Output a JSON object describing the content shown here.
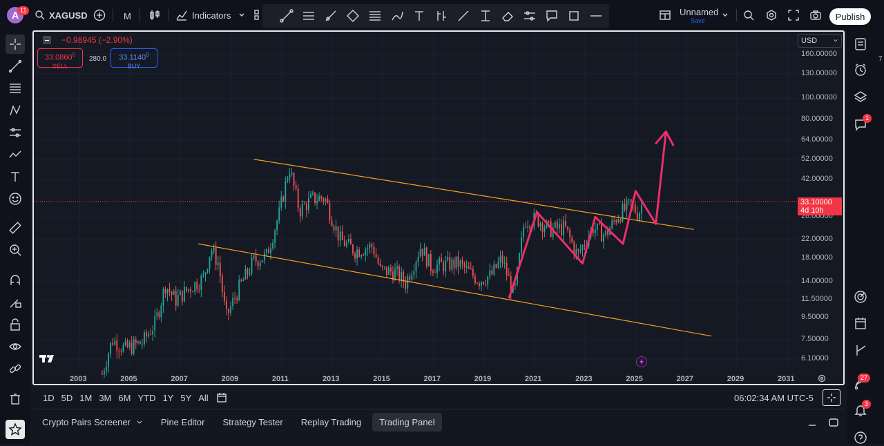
{
  "topbar": {
    "avatar_letter": "A",
    "avatar_badge": "11",
    "symbol": "XAGUSD",
    "interval": "M",
    "indicators_label": "Indicators",
    "layout_name": "Unnamed",
    "layout_save": "Save",
    "publish_label": "Publish"
  },
  "trade_panel": {
    "change": "−0.98945 (−2.90%)",
    "sell_price": "33.0860",
    "sell_price_sup": "0",
    "sell_label": "SELL",
    "spread": "280.0",
    "buy_price": "33.1140",
    "buy_price_sup": "0",
    "buy_label": "BUY"
  },
  "price_axis": {
    "currency": "USD",
    "labels": [
      "160.00000",
      "130.00000",
      "100.00000",
      "80.00000",
      "64.00000",
      "52.00000",
      "42.00000",
      "33.10000",
      "28.00000",
      "22.00000",
      "18.00000",
      "14.00000",
      "11.50000",
      "9.50000",
      "7.50000",
      "6.10000"
    ],
    "current_price": "33.10000",
    "countdown": "4d 10h"
  },
  "time_axis": {
    "years": [
      "2003",
      "2005",
      "2007",
      "2009",
      "2011",
      "2013",
      "2015",
      "2017",
      "2019",
      "2021",
      "2023",
      "2025",
      "2027",
      "2029",
      "2031"
    ]
  },
  "bottom_toolbar": {
    "ranges": [
      "1D",
      "5D",
      "1M",
      "3M",
      "6M",
      "YTD",
      "1Y",
      "5Y",
      "All"
    ],
    "clock": "06:02:34 AM UTC-5"
  },
  "bottom_tabs": [
    "Crypto Pairs Screener",
    "Pine Editor",
    "Strategy Tester",
    "Replay Trading",
    "Trading Panel"
  ],
  "right_badges": {
    "chat": "1",
    "ideas": "27",
    "alerts": "3"
  },
  "colors": {
    "up": "#26a69a",
    "down": "#ef5350",
    "channel": "#f7a21b",
    "projection": "#ea2e6a",
    "price_tag": "#f23645"
  },
  "chart_data": {
    "type": "candlestick",
    "symbol": "XAGUSD",
    "interval": "1M",
    "scale": "log",
    "x_range": [
      "2002",
      "2032"
    ],
    "y_range": [
      5.7,
      185
    ],
    "close_series": [
      {
        "t": 2003.9,
        "v": 5.2
      },
      {
        "t": 2004.3,
        "v": 7.5
      },
      {
        "t": 2004.8,
        "v": 6.8
      },
      {
        "t": 2005.5,
        "v": 7.3
      },
      {
        "t": 2006.0,
        "v": 9.0
      },
      {
        "t": 2006.4,
        "v": 13.5
      },
      {
        "t": 2006.8,
        "v": 11.5
      },
      {
        "t": 2007.4,
        "v": 13.2
      },
      {
        "t": 2007.9,
        "v": 14.5
      },
      {
        "t": 2008.2,
        "v": 20.0
      },
      {
        "t": 2008.5,
        "v": 17.0
      },
      {
        "t": 2008.8,
        "v": 9.5
      },
      {
        "t": 2009.3,
        "v": 13.0
      },
      {
        "t": 2009.9,
        "v": 17.5
      },
      {
        "t": 2010.4,
        "v": 18.5
      },
      {
        "t": 2010.9,
        "v": 29.0
      },
      {
        "t": 2011.3,
        "v": 48.0
      },
      {
        "t": 2011.7,
        "v": 30.0
      },
      {
        "t": 2012.2,
        "v": 34.0
      },
      {
        "t": 2012.7,
        "v": 34.5
      },
      {
        "t": 2013.3,
        "v": 22.0
      },
      {
        "t": 2013.9,
        "v": 19.5
      },
      {
        "t": 2014.6,
        "v": 20.5
      },
      {
        "t": 2014.9,
        "v": 15.8
      },
      {
        "t": 2015.5,
        "v": 15.5
      },
      {
        "t": 2015.9,
        "v": 13.8
      },
      {
        "t": 2016.5,
        "v": 20.5
      },
      {
        "t": 2016.9,
        "v": 16.5
      },
      {
        "t": 2017.5,
        "v": 16.8
      },
      {
        "t": 2018.0,
        "v": 17.0
      },
      {
        "t": 2018.8,
        "v": 14.2
      },
      {
        "t": 2019.3,
        "v": 15.0
      },
      {
        "t": 2019.7,
        "v": 18.0
      },
      {
        "t": 2020.2,
        "v": 12.0
      },
      {
        "t": 2020.6,
        "v": 27.0
      },
      {
        "t": 2021.1,
        "v": 27.5
      },
      {
        "t": 2021.6,
        "v": 24.5
      },
      {
        "t": 2022.2,
        "v": 25.0
      },
      {
        "t": 2022.7,
        "v": 18.5
      },
      {
        "t": 2023.3,
        "v": 25.0
      },
      {
        "t": 2023.8,
        "v": 23.0
      },
      {
        "t": 2024.3,
        "v": 28.5
      },
      {
        "t": 2024.8,
        "v": 32.0
      },
      {
        "t": 2025.1,
        "v": 29.0
      },
      {
        "t": 2025.3,
        "v": 33.1
      }
    ],
    "current_price": 33.1,
    "channel_upper": [
      {
        "t": 2009.9,
        "v": 52.0
      },
      {
        "t": 2027.3,
        "v": 24.5
      }
    ],
    "channel_lower": [
      {
        "t": 2007.7,
        "v": 21.0
      },
      {
        "t": 2028.0,
        "v": 7.8
      }
    ],
    "projection_path": [
      {
        "t": 2020.0,
        "v": 11.8
      },
      {
        "t": 2021.1,
        "v": 29.5
      },
      {
        "t": 2022.9,
        "v": 17.0
      },
      {
        "t": 2023.4,
        "v": 28.0
      },
      {
        "t": 2024.5,
        "v": 21.0
      },
      {
        "t": 2025.0,
        "v": 37.0
      },
      {
        "t": 2025.8,
        "v": 26.0
      },
      {
        "t": 2026.2,
        "v": 70.0
      }
    ]
  }
}
